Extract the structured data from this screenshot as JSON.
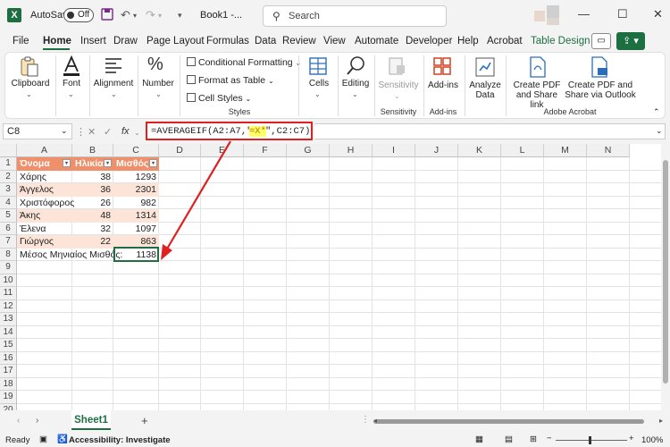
{
  "titlebar": {
    "logo": "X",
    "autosave_label": "AutoSave",
    "autosave_state": "Off",
    "doc_title": "Book1  -...",
    "search_placeholder": "Search",
    "icons": [
      "save-icon",
      "undo-icon",
      "redo-icon",
      "customize-icon",
      "minimize-icon",
      "maximize-icon",
      "close-icon"
    ]
  },
  "menu": {
    "items": [
      "File",
      "Home",
      "Insert",
      "Draw",
      "Page Layout",
      "Formulas",
      "Data",
      "Review",
      "View",
      "Automate",
      "Developer",
      "Help",
      "Acrobat",
      "Table Design"
    ],
    "active": "Home"
  },
  "ribbon": {
    "clipboard": "Clipboard",
    "font": "Font",
    "alignment": "Alignment",
    "number": "Number",
    "conditional_formatting": "Conditional Formatting",
    "format_as_table": "Format as Table",
    "cell_styles": "Cell Styles",
    "styles_group": "Styles",
    "cells": "Cells",
    "editing": "Editing",
    "sensitivity": "Sensitivity",
    "sensitivity_group": "Sensitivity",
    "addins": "Add-ins",
    "addins_group": "Add-ins",
    "analyze_data_1": "Analyze",
    "analyze_data_2": "Data",
    "create_pdf_1": "Create PDF",
    "create_pdf_2": "and Share link",
    "create_pdf_outlook_1": "Create PDF and",
    "create_pdf_outlook_2": "Share via Outlook",
    "acrobat_group": "Adobe Acrobat"
  },
  "formula_bar": {
    "name_box": "C8",
    "fx": "fx",
    "formula_prefix": "=AVERAGEIF(A2:A7,\"",
    "formula_highlight": "=X*",
    "formula_suffix": "\",C2:C7)"
  },
  "sheet": {
    "columns": [
      "A",
      "B",
      "C",
      "D",
      "E",
      "F",
      "G",
      "H",
      "I",
      "J",
      "K",
      "L",
      "M",
      "N"
    ],
    "rows": [
      "1",
      "2",
      "3",
      "4",
      "5",
      "6",
      "7",
      "8",
      "9",
      "10",
      "11",
      "12",
      "13",
      "14",
      "15",
      "16",
      "17",
      "18",
      "19",
      "20"
    ],
    "table_headers": [
      "Όνομα",
      "Ηλικία",
      "Μισθός"
    ],
    "table_rows": [
      [
        "Χάρης",
        "38",
        "1293"
      ],
      [
        "Άγγελος",
        "36",
        "2301"
      ],
      [
        "Χριστόφορος",
        "26",
        "982"
      ],
      [
        "Άκης",
        "48",
        "1314"
      ],
      [
        "Έλενα",
        "32",
        "1097"
      ],
      [
        "Γιώργος",
        "22",
        "863"
      ]
    ],
    "summary_label": "Μέσος Μηνιαίος Μισθός:",
    "summary_value": "1138"
  },
  "tabs": {
    "sheet_name": "Sheet1",
    "add": "+"
  },
  "status": {
    "ready": "Ready",
    "accessibility": "Accessibility: Investigate",
    "zoom": "100%"
  },
  "colors": {
    "excel_green": "#1d6f42",
    "table_header": "#f0906a",
    "table_band": "#fde4d8",
    "annotation_red": "#e02020"
  }
}
